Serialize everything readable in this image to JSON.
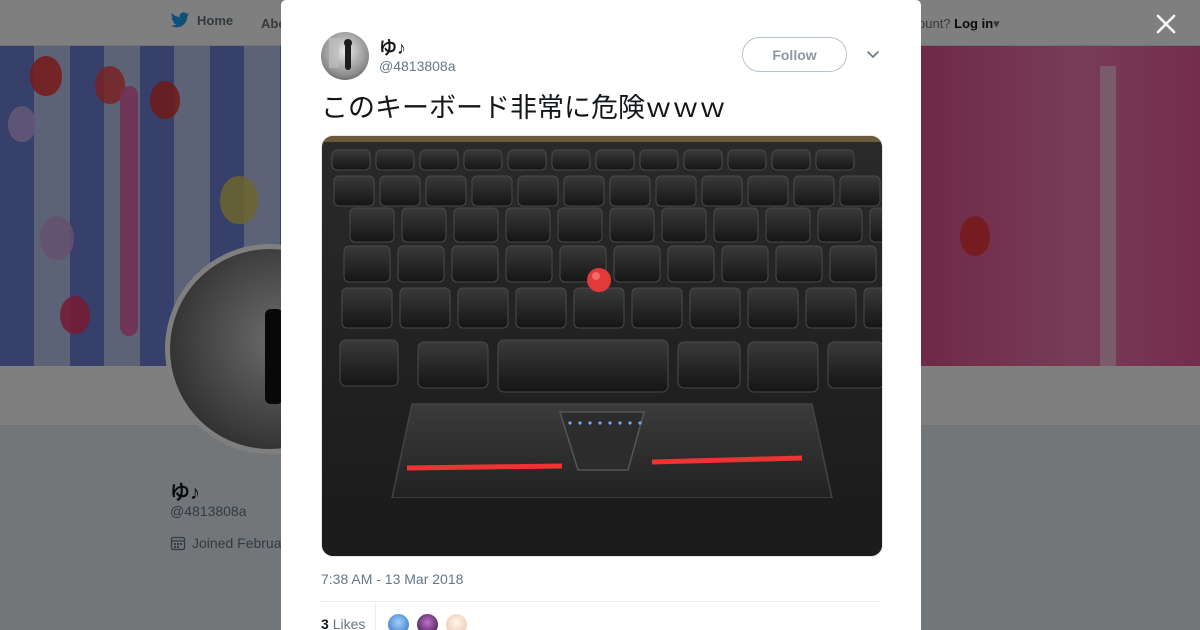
{
  "nav": {
    "home_label": "Home",
    "about_partial": "Abo",
    "account_prompt_partial": "ccount?",
    "login_label": "Log in"
  },
  "profile_bg": {
    "name": "ゆ♪",
    "handle": "@4813808a",
    "joined_partial": "Joined Februa"
  },
  "tweet": {
    "author_name": "ゆ♪",
    "author_handle": "@4813808a",
    "follow_label": "Follow",
    "text": "このキーボード非常に危険ｗｗｗ",
    "timestamp": "7:38 AM - 13 Mar 2018",
    "likes_count": "3",
    "likes_label": "Likes"
  },
  "colors": {
    "accent": "#1da1f2",
    "trackpoint": "#d32b2b",
    "overlay": "rgba(0,0,0,0.5)"
  },
  "icons": [
    "twitter-bird-icon",
    "close-icon",
    "chevron-down-icon",
    "calendar-icon",
    "caret-down-icon"
  ]
}
